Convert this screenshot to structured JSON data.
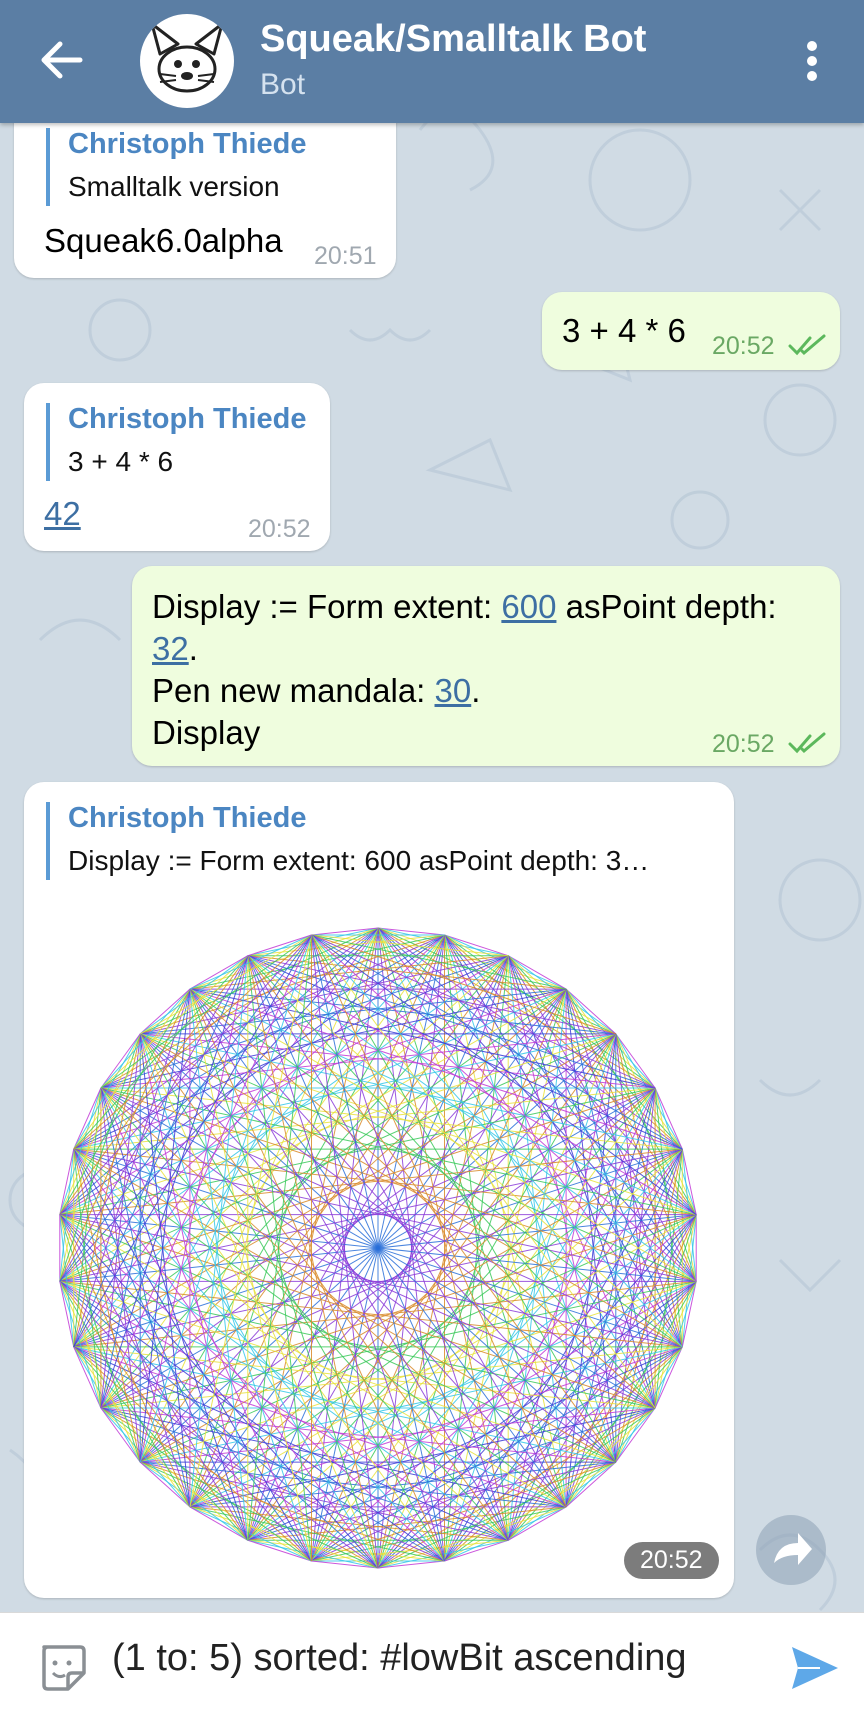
{
  "header": {
    "title": "Squeak/Smalltalk Bot",
    "subtitle": "Bot",
    "back_icon": "arrow-left-icon",
    "menu_icon": "more-vertical-icon",
    "bar_color": "#5b7ea4"
  },
  "messages": [
    {
      "direction": "in",
      "reply_name": "Christoph Thiede",
      "reply_text": "Smalltalk version",
      "text": "Squeak6.0alpha",
      "time": "20:51"
    },
    {
      "direction": "out",
      "text": "3 + 4 * 6",
      "time": "20:52",
      "status": "read"
    },
    {
      "direction": "in",
      "reply_name": "Christoph Thiede",
      "reply_text": "3 + 4 * 6",
      "text": "42",
      "time": "20:52"
    },
    {
      "direction": "out",
      "line1_a": "Display := Form extent: ",
      "line1_link": "600",
      "line1_b": " asPoint depth:",
      "line2_link": "32",
      "line2_b": ".",
      "line3_a": "Pen new mandala: ",
      "line3_link": "30",
      "line3_b": ".",
      "line4": "Display",
      "time": "20:52",
      "status": "read"
    },
    {
      "direction": "in",
      "reply_name": "Christoph Thiede",
      "reply_text": "Display := Form extent: 600 asPoint depth: 3…",
      "image": "mandala-image",
      "time": "20:52"
    }
  ],
  "input": {
    "value": "(1 to: 5) sorted: #lowBit ascending",
    "sticker_icon": "sticker-icon",
    "send_icon": "send-icon",
    "send_color": "#5ea8e8"
  },
  "colors": {
    "incoming_bubble": "#ffffff",
    "outgoing_bubble": "#effdde",
    "link": "#3d6fa3",
    "reply_bar": "#5b9bd5"
  }
}
